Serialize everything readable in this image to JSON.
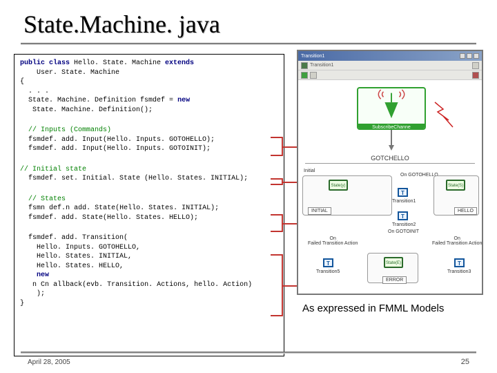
{
  "title": "State.Machine. java",
  "code": {
    "l1a": "public class",
    "l1b": " Hello. State. Machine ",
    "l1c": "extends",
    "l2": "    User. State. Machine",
    "l3": "{",
    "l4": "  . . .",
    "l5a": "  State. Machine. Definition fsmdef = ",
    "l5b": "new",
    "l6": "   State. Machine. Definition();",
    "c1": "  // Inputs (Commands)",
    "l7": "  fsmdef. add. Input(Hello. Inputs. GOTOHELLO);",
    "l8": "  fsmdef. add. Input(Hello. Inputs. GOTOINIT);",
    "c2": "// Initial state",
    "l9": "  fsmdef. set. Initial. State (Hello. States. INITIAL);",
    "c3": "  // States",
    "l10a": "  fsm",
    "l10bullet": "n ",
    "l10b": "def.",
    "l10bullet2": "n ",
    "l10c": "add. State(Hello. States. INITIAL);",
    "l11": "  fsmdef. add. State(Hello. States. HELLO);",
    "l12": "  fsmdef. add. Transition(",
    "l13": "    Hello. Inputs. GOTOHELLO,",
    "l14": "    Hello. States. INITIAL,",
    "l15": "    Hello. States. HELLO,",
    "l16a": "    ",
    "l16b": "new",
    "l17a": "   ",
    "l17bullet": "n ",
    "l17b": "C",
    "l17bullet2": "n ",
    "l17c": "allback(evb. Transition. Actions, hello. Action)",
    "l18": "    );",
    "l19": "}"
  },
  "diagram": {
    "titlebar": "Transition1",
    "subscribe": "SubscribeChanne",
    "gotchello": "GOTCHELLO",
    "initial_label": "Initial",
    "state_y": "State(y)",
    "state_s": "State(S)",
    "on_gotohello": "On GOTOHELLO",
    "initial_box": "INITIAL",
    "hello_box": "HELLO",
    "state_e": "State(E)",
    "error_box": "ERROR",
    "t_label": "T",
    "transition1": "Transition1",
    "transition2": "Transition2",
    "transition3": "Transition3",
    "transition5": "Transition5",
    "on_gotoinit": "On GOTOINIT",
    "on_failed_l": "On\nFailed Transition Action",
    "on_failed_r": "On\nFailed Transition Action"
  },
  "caption": "As expressed in FMML Models",
  "footer": {
    "date": "April 28, 2005",
    "page": "25"
  }
}
